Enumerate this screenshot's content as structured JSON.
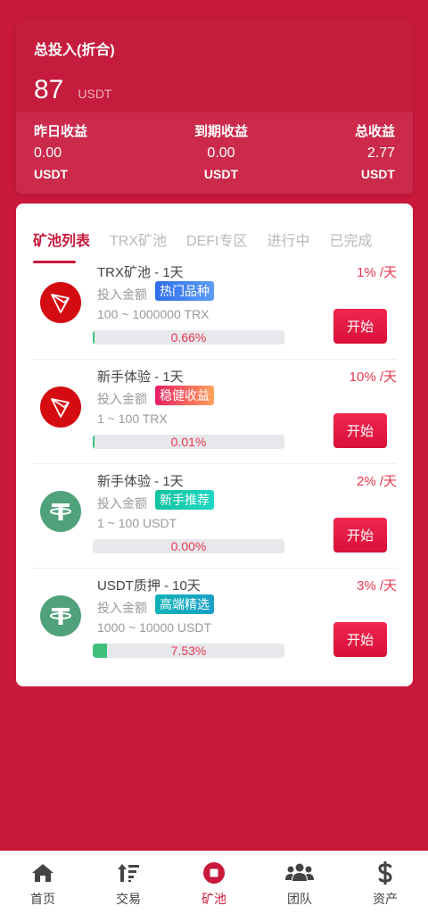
{
  "summary": {
    "title": "总投入(折合)",
    "amount": "87",
    "unit": "USDT",
    "stats": [
      {
        "label": "昨日收益",
        "value": "0.00",
        "unit": "USDT"
      },
      {
        "label": "到期收益",
        "value": "0.00",
        "unit": "USDT"
      },
      {
        "label": "总收益",
        "value": "2.77",
        "unit": "USDT"
      }
    ]
  },
  "tabs": [
    {
      "label": "矿池列表",
      "active": true
    },
    {
      "label": "TRX矿池",
      "active": false
    },
    {
      "label": "DEFI专区",
      "active": false
    },
    {
      "label": "进行中",
      "active": false
    },
    {
      "label": "已完成",
      "active": false
    }
  ],
  "pools": [
    {
      "coin": "trx-coin-icon",
      "name": "TRX矿池 - 1天",
      "rate": "1% /天",
      "invest_label": "投入金额",
      "badge": "热门品种",
      "badge_color": "#2f6ee9",
      "range": "100 ~ 1000000 TRX",
      "progress": 0.0066,
      "progress_text": "0.66%",
      "button": "开始"
    },
    {
      "coin": "trx-coin-icon",
      "name": "新手体验 - 1天",
      "rate": "10% /天",
      "invest_label": "投入金额",
      "badge": "稳健收益",
      "badge_color": "#e91e63",
      "range": "1 ~ 100 TRX",
      "progress": 0.0001,
      "progress_text": "0.01%",
      "button": "开始"
    },
    {
      "coin": "usdt-coin-icon",
      "name": "新手体验 - 1天",
      "rate": "2% /天",
      "invest_label": "投入金额",
      "badge": "新手推荐",
      "badge_color": "#14c3a0",
      "range": "1 ~ 100 USDT",
      "progress": 0.0,
      "progress_text": "0.00%",
      "button": "开始"
    },
    {
      "coin": "usdt-coin-icon",
      "name": "USDT质押 - 10天",
      "rate": "3% /天",
      "invest_label": "投入金额",
      "badge": "高端精选",
      "badge_color": "#0fb3b6",
      "range": "1000 ~ 10000 USDT",
      "progress": 0.0753,
      "progress_text": "7.53%",
      "button": "开始"
    }
  ],
  "nav": [
    {
      "label": "首页",
      "icon": "home-icon",
      "active": false
    },
    {
      "label": "交易",
      "icon": "sort-icon",
      "active": false
    },
    {
      "label": "矿池",
      "icon": "stop-circle-icon",
      "active": true
    },
    {
      "label": "团队",
      "icon": "users-icon",
      "active": false
    },
    {
      "label": "资产",
      "icon": "dollar-icon",
      "active": false
    }
  ],
  "colors": {
    "brand": "#c8193c",
    "rate": "#e9374f",
    "progress_fill": "#3ec07a"
  }
}
